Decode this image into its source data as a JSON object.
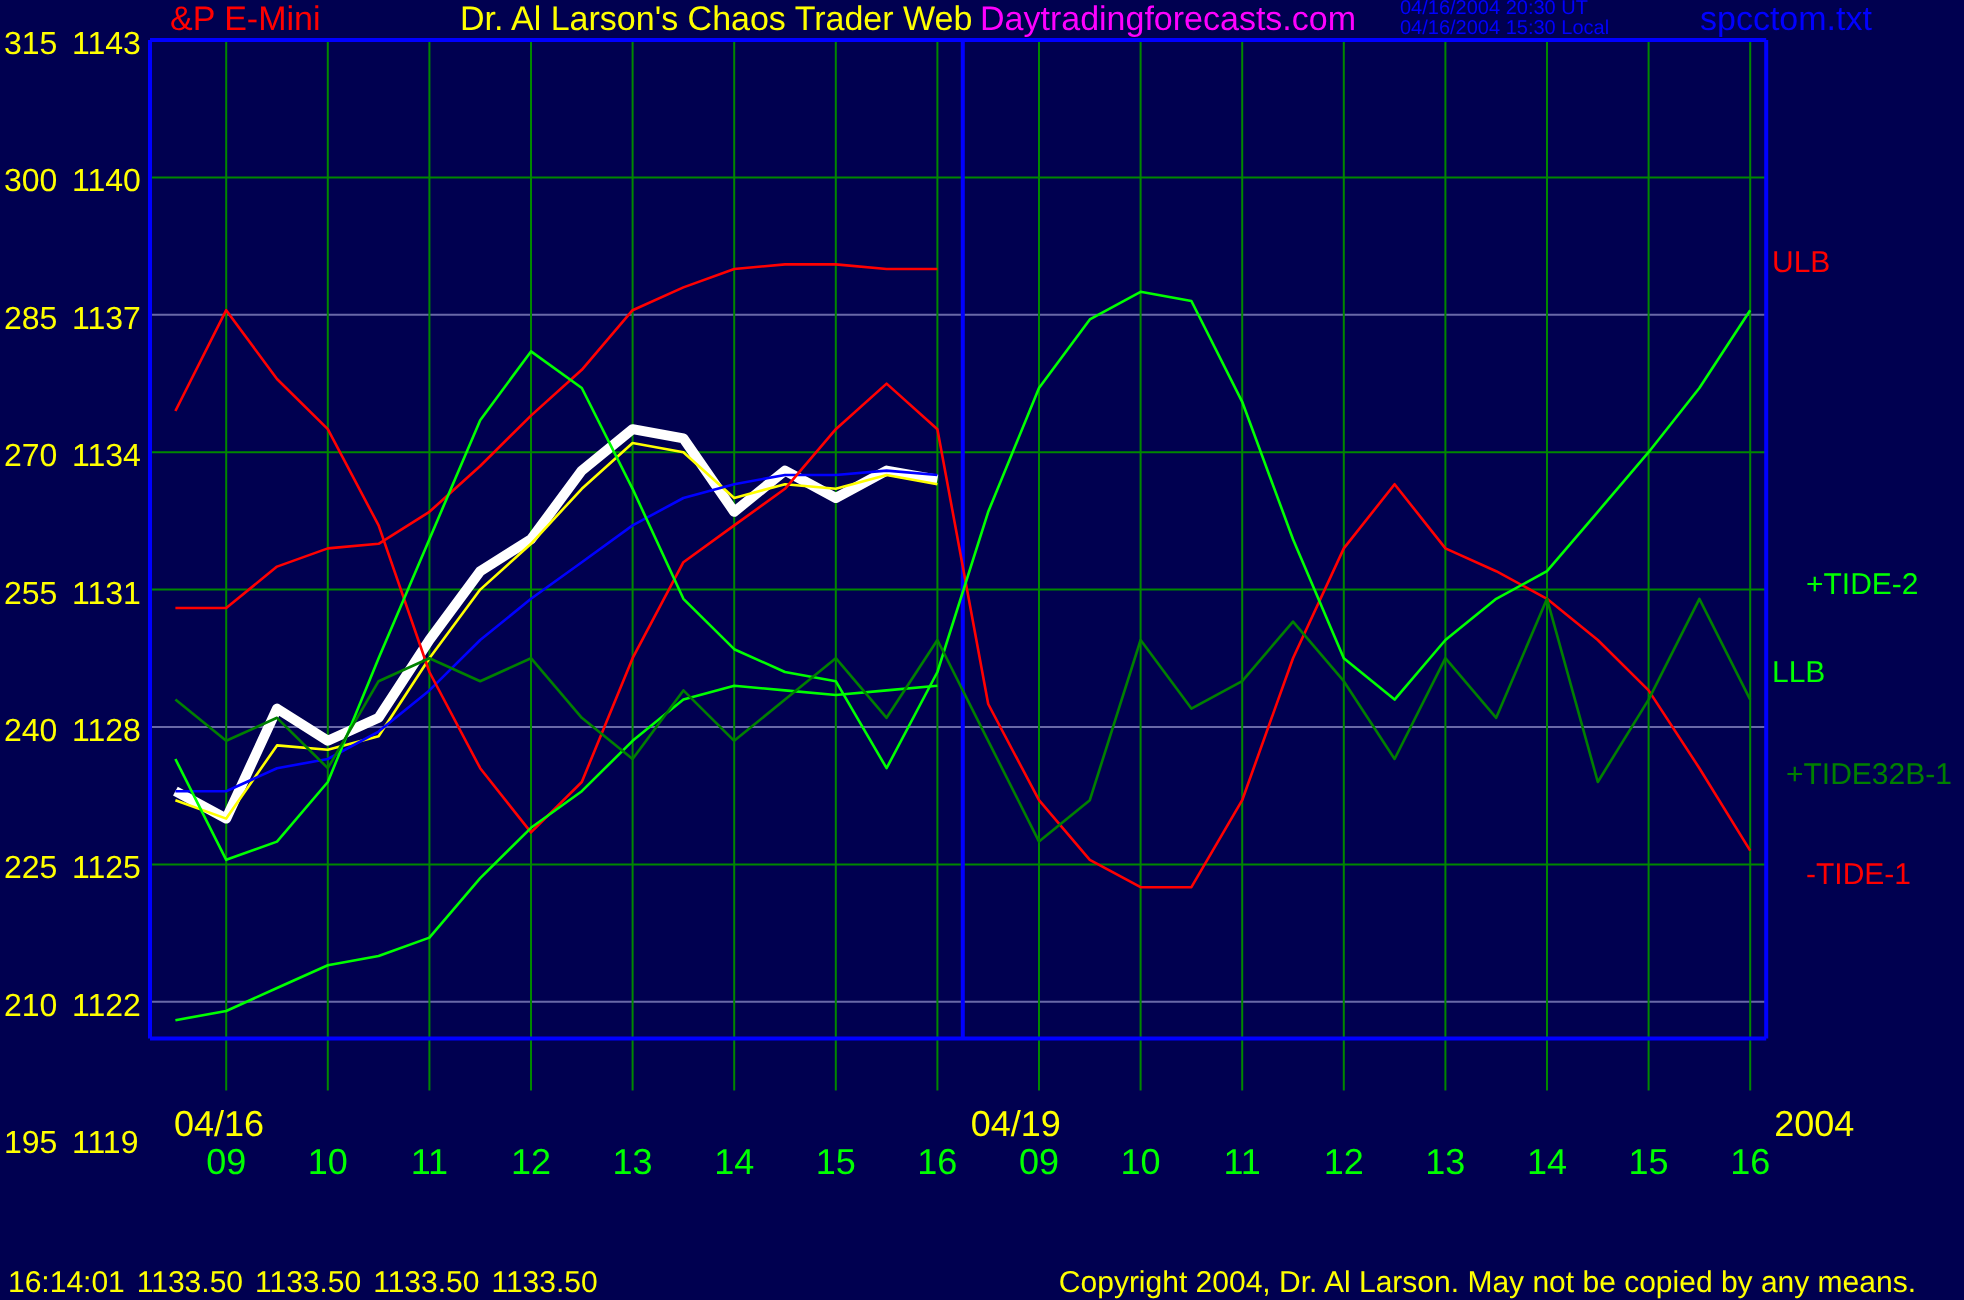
{
  "header": {
    "instrument": "&P E-Mini",
    "author": "Dr. Al Larson's Chaos Trader Web",
    "site": "Daytradingforecasts.com",
    "timestamps": [
      "04/16/2004 20:30 UT",
      "04/16/2004 15:30 Local"
    ],
    "file": "spcctom.txt"
  },
  "chart": {
    "secondary_scale": [
      "315",
      "300",
      "285",
      "270",
      "255",
      "240",
      "225",
      "210",
      "195"
    ],
    "date_labels": [
      "04/16",
      "04/19",
      "2004"
    ],
    "bottom_label": "1119",
    "chart_data": {
      "type": "line",
      "categories": [
        null,
        "09",
        null,
        "10",
        null,
        "11",
        null,
        "12",
        null,
        "13",
        null,
        "14",
        null,
        "15",
        null,
        "16",
        null,
        "09",
        null,
        "10",
        null,
        "11",
        null,
        "12",
        null,
        "13",
        null,
        "14",
        null,
        "15",
        null,
        "16"
      ],
      "ylim": [
        1121.2,
        1143
      ],
      "grid": true,
      "yticks": [
        1143,
        1140,
        1137,
        1134,
        1131,
        1128,
        1125,
        1122
      ],
      "series": [
        {
          "color": "#ffffff",
          "values": [
            1126.6,
            1126.0,
            1128.4,
            1127.7,
            1128.2,
            1129.9,
            1131.4,
            1132.1,
            1133.6,
            1134.5,
            1134.3,
            1132.7,
            1133.6,
            1133.0,
            1133.6,
            1133.4,
            null,
            null,
            null,
            null,
            null,
            null,
            null,
            null,
            null,
            null,
            null,
            null,
            null,
            null,
            null,
            null
          ]
        },
        {
          "color": "#ffff00",
          "values": [
            1126.4,
            1126.0,
            1127.6,
            1127.5,
            1127.8,
            1129.5,
            1131.0,
            1132.0,
            1133.2,
            1134.2,
            1134.0,
            1133.0,
            1133.3,
            1133.2,
            1133.5,
            1133.3,
            null,
            null,
            null,
            null,
            null,
            null,
            null,
            null,
            null,
            null,
            null,
            null,
            null,
            null,
            null,
            null
          ]
        },
        {
          "color": "#0000ff",
          "values": [
            1126.6,
            1126.6,
            1127.1,
            1127.3,
            1127.9,
            1128.8,
            1129.9,
            1130.8,
            1131.6,
            1132.4,
            1133.0,
            1133.3,
            1133.5,
            1133.5,
            1133.6,
            1133.5,
            null,
            null,
            null,
            null,
            null,
            null,
            null,
            null,
            null,
            null,
            null,
            null,
            null,
            null,
            null,
            null
          ]
        },
        {
          "name": "ULB",
          "color": "#ff0000",
          "values": [
            1130.6,
            1130.6,
            1131.5,
            1131.9,
            1132.0,
            1132.7,
            1133.7,
            1134.8,
            1135.8,
            1137.1,
            1137.6,
            1138.0,
            1138.1,
            1138.1,
            1138.0,
            1138.0,
            null,
            null,
            null,
            null,
            null,
            null,
            null,
            null,
            null,
            null,
            null,
            null,
            null,
            null,
            null,
            null
          ]
        },
        {
          "name": "-TIDE-1",
          "color": "#ff0000",
          "values": [
            1134.9,
            1137.1,
            1135.6,
            1134.5,
            1132.4,
            1129.2,
            1127.1,
            1125.7,
            1126.8,
            1129.5,
            1131.6,
            1132.4,
            1133.2,
            1134.5,
            1135.5,
            1134.5,
            1128.5,
            1126.4,
            1125.1,
            1124.5,
            1124.5,
            1126.4,
            1129.5,
            1131.9,
            1133.3,
            1131.9,
            1131.4,
            1130.8,
            1129.9,
            1128.8,
            1127.1,
            1125.3
          ]
        },
        {
          "name": "+TIDE-2",
          "color": "#00ff00",
          "values": [
            1127.3,
            1125.1,
            1125.5,
            1126.8,
            1129.5,
            1132.1,
            1134.7,
            1136.2,
            1135.4,
            1133.2,
            1130.8,
            1129.7,
            1129.2,
            1129.0,
            1127.1,
            1129.2,
            1132.7,
            1135.4,
            1136.9,
            1137.5,
            1137.3,
            1135.1,
            1132.1,
            1129.5,
            1128.6,
            1129.9,
            1130.8,
            1131.4,
            1132.7,
            1134.0,
            1135.4,
            1137.1
          ]
        },
        {
          "name": "LLB",
          "color": "#00ff00",
          "values": [
            1121.6,
            1121.8,
            1122.3,
            1122.8,
            1123.0,
            1123.4,
            1124.7,
            1125.8,
            1126.6,
            1127.7,
            1128.6,
            1128.9,
            1128.8,
            1128.7,
            1128.8,
            1128.9,
            null,
            null,
            null,
            null,
            null,
            null,
            null,
            null,
            null,
            null,
            null,
            null,
            null,
            null,
            null,
            null
          ]
        },
        {
          "name": "+TIDE32B-1",
          "color": "#008000",
          "values": [
            1128.6,
            1127.7,
            1128.2,
            1127.1,
            1129.0,
            1129.5,
            1129.0,
            1129.5,
            1128.2,
            1127.3,
            1128.8,
            1127.7,
            1128.6,
            1129.5,
            1128.2,
            1129.9,
            1127.7,
            1125.5,
            1126.4,
            1129.9,
            1128.4,
            1129.0,
            1130.3,
            1129.0,
            1127.3,
            1129.5,
            1128.2,
            1130.8,
            1126.8,
            1128.6,
            1130.8,
            1128.6
          ]
        }
      ]
    }
  },
  "status_bar": {
    "time": "16:14:01",
    "values": [
      "1133.50",
      "1133.50",
      "1133.50",
      "1133.50"
    ],
    "copyright": "Copyright 2004, Dr. Al Larson. May not be copied by any means."
  }
}
